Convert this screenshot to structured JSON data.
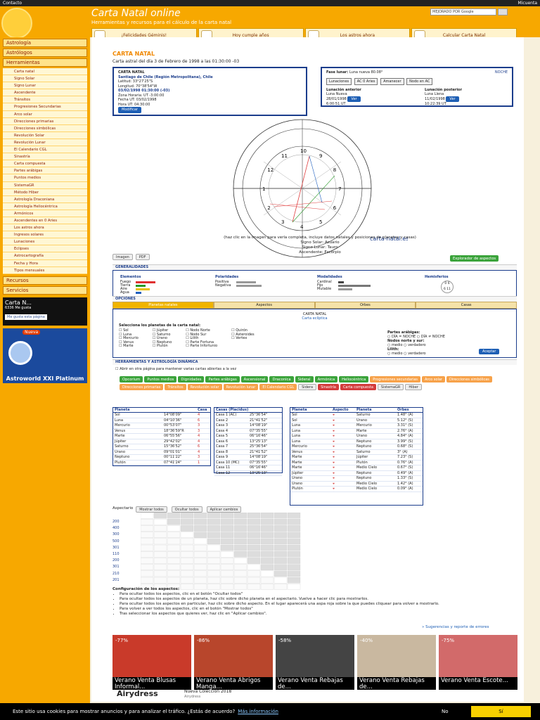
{
  "topbar": {
    "contact": "Contacto",
    "account": "Micuenta"
  },
  "header": {
    "brand": "Carta Natal online",
    "subtitle": "Herramientas y recursos para el cálculo de la carta natal",
    "search_placeholder": "MEJORADO POR Google",
    "nav": [
      "¡Felicidades Géminis!",
      "Hoy cumple años",
      "Los astros ahora",
      "Calcular Carta Natal"
    ]
  },
  "sidebar": {
    "sections": [
      {
        "label": "Astrología"
      },
      {
        "label": "Astrólogos"
      },
      {
        "label": "Herramientas"
      }
    ],
    "tools": [
      "Carta natal",
      "Signo Solar",
      "Signo Lunar",
      "Ascendente",
      "Tránsitos",
      "Progresiones Secundarias",
      "Arco solar",
      "Direcciones primarias",
      "Direcciones simbólicas",
      "Revolución Solar",
      "Revolución Lunar",
      "El Calendario CGL",
      "Sinastría",
      "Carta compuesta",
      "Partes arábigas",
      "Puntos medios",
      "SistemaGR",
      "Método Hiber",
      "Astrología Draconiana",
      "Astrología Heliocéntrica",
      "Armónicos",
      "Ascendentes en 0 Aries",
      "Los astros ahora",
      "Ingresos solares",
      "Lunaciones",
      "Eclipses",
      "Astrocartografía",
      "Fecha y Hora",
      "Tipos mensuales"
    ],
    "bottom": [
      "Recursos",
      "Servicios"
    ],
    "fb_card": {
      "title": "Carta N...",
      "likes": "6336 Me gusta",
      "like_btn": "Me gusta esta página"
    },
    "product": {
      "badge": "Nueva",
      "name": "Astroworld XXI Platinum"
    }
  },
  "main": {
    "title": "CARTA NATAL",
    "subtitle": "Carta astral del día 3 de Febrero de 1998 a las 01:30:00 -03",
    "box1": {
      "heading": "CARTA NATAL",
      "place": "Santiago de Chile (Región Metropolitana), Chile",
      "lat": "Latitud: 33°27'25\"S",
      "lon": "Longitud: 70°38'54\"W",
      "date": "03/02/1998 01:30:00 (-03)",
      "tz": "Zona Horaria: UT -3:00:00",
      "ut_date": "Fecha UT: 03/02/1998",
      "ut_time": "Hora UT: 04:30:00",
      "modify": "Modificar"
    },
    "box2": {
      "phase_label": "Fase lunar:",
      "phase": "Luna nueva 80.08°",
      "night": "NOCHE",
      "buttons": [
        "Lunaciones",
        "AC 0 Aries",
        "Amanecer",
        "Nodo en AC"
      ],
      "prev_label": "Lunación anterior",
      "prev_type": "Luna Nueva",
      "prev_date": "28/01/1998",
      "prev_time": "6:00:51 UT",
      "next_label": "Lunación posterior",
      "next_type": "Luna Llena",
      "next_date": "11/02/1998",
      "next_time": "10:22:39 UT",
      "ver": "Ver"
    },
    "chart_caption": "(haz clic en la imagen para verla completa, incluye datos natales y posiciones de planetas y casas)",
    "sign_solar": "Signo Solar: Acuario",
    "sign_lunar": "Signo Lunar: Tauro",
    "ascendente": "Ascendente: Escorpio",
    "chart_site": "carta-natal.es",
    "house_numbers": [
      "1",
      "2",
      "3",
      "4",
      "5",
      "6",
      "7",
      "8",
      "9",
      "10",
      "11",
      "12"
    ],
    "img_btn": "Imagen",
    "pdf_btn": "PDF",
    "aspects_explorer": "Explorador de aspectos",
    "general": {
      "title": "GENERALIDADES",
      "elements_title": "Elementos",
      "elements": [
        "Fuego",
        "Tierra",
        "Aire",
        "Agua"
      ],
      "polarity_title": "Polaridades",
      "polarity": [
        "Positiva",
        "Negativa"
      ],
      "modal_title": "Modalidades",
      "modal": [
        "Cardinal",
        "Fijo",
        "Mutable"
      ],
      "hemi_title": "Hemisferios",
      "hemi_values": [
        "0",
        "6",
        "6",
        "11"
      ]
    },
    "options": {
      "title": "OPCIONES",
      "tabs": [
        "Planetas natales",
        "Aspectos",
        "Orbes",
        "Casas"
      ],
      "chart_label": "CARTA NATAL",
      "chart_sub": "Carta eclíptica",
      "prompt": "Selecciona los planetas de la carta natal:",
      "col1": [
        "Sol",
        "Luna",
        "Mercurio",
        "Venus",
        "Marte"
      ],
      "col2": [
        "Júpiter",
        "Saturno",
        "Urano",
        "Neptuno",
        "Plutón"
      ],
      "col3": [
        "Nodo Norte",
        "Nodo Sur",
        "Lilith",
        "Parte Fortuna",
        "Parte Infortunio"
      ],
      "col4": [
        "Quirón",
        "Asteroides",
        "Vertex"
      ],
      "arabic_label": "Partes arábigas:",
      "arabic_opts": [
        "DÍA = NOCHE",
        "DÍA ≠ NOCHE"
      ],
      "nodes_label": "Nodos norte y sur:",
      "nodes_opts": [
        "medio",
        "verdadero"
      ],
      "lilith_label": "Lilith:",
      "lilith_opts": [
        "medio",
        "verdadero"
      ],
      "accept": "Aceptar"
    },
    "dyn_title": "HERRAMIENTAS Y ASTROLOGÍA DINÁMICA",
    "dyn_check": "Abrir en otra página para mantener varias cartas abiertas a la vez",
    "tools_green": [
      "Opcorium",
      "Puntos medios",
      "Dignidades",
      "Partes arábigas",
      "Ascensional",
      "Draconica",
      "Sideral",
      "Armónica",
      "Heliocéntrica"
    ],
    "tools_orange": [
      "Progresiones secundarias",
      "Arco solar",
      "Direcciones simbólicas",
      "Direcciones primarias",
      "Tránsitos",
      "Revolución solar",
      "Revolución lunar",
      "El Calendario CGL"
    ],
    "tools_red": [
      "Sinastría",
      "Carta compuesta"
    ],
    "tools_grey": [
      "Sidera",
      "SistemaGR",
      "Hiber"
    ],
    "planets_table": {
      "headers": [
        "Planeta",
        "",
        "Casa"
      ],
      "rows": [
        {
          "name": "Sol",
          "pos": "14°08'09\"",
          "casa": "4"
        },
        {
          "name": "Luna",
          "pos": "04°10'36\"",
          "casa": "6"
        },
        {
          "name": "Mercurio",
          "pos": "00°53'07\"",
          "casa": "3"
        },
        {
          "name": "Venus",
          "pos": "18°36'59\"R",
          "casa": "3"
        },
        {
          "name": "Marte",
          "pos": "06°55'56\"",
          "casa": "4"
        },
        {
          "name": "Júpiter",
          "pos": "29°42'02\"",
          "casa": "4"
        },
        {
          "name": "Saturno",
          "pos": "15°36'52\"",
          "casa": "6"
        },
        {
          "name": "Urano",
          "pos": "09°01'01\"",
          "casa": "4"
        },
        {
          "name": "Neptuno",
          "pos": "00°11'22\"",
          "casa": "3"
        },
        {
          "name": "Plutón",
          "pos": "07°41'24\"",
          "casa": "1"
        }
      ]
    },
    "houses_table": {
      "header": "Casas (Placidus)",
      "rows": [
        {
          "name": "Casa 1 (AC)",
          "pos": "25°36'54\""
        },
        {
          "name": "Casa 2",
          "pos": "21°41'52\""
        },
        {
          "name": "Casa 3",
          "pos": "14°08'19\""
        },
        {
          "name": "Casa 4",
          "pos": "07°35'55\""
        },
        {
          "name": "Casa 5",
          "pos": "06°16'46\""
        },
        {
          "name": "Casa 6",
          "pos": "13°25'13\""
        },
        {
          "name": "Casa 7",
          "pos": "25°36'54\""
        },
        {
          "name": "Casa 8",
          "pos": "21°41'52\""
        },
        {
          "name": "Casa 9",
          "pos": "14°08'19\""
        },
        {
          "name": "Casa 10 (MC)",
          "pos": "07°35'55\""
        },
        {
          "name": "Casa 11",
          "pos": "06°16'46\""
        },
        {
          "name": "Casa 12",
          "pos": "13°25'13\""
        }
      ]
    },
    "aspects_table": {
      "headers": [
        "Planeta",
        "Aspecto",
        "Planeta",
        "Orbes"
      ],
      "rows": [
        {
          "p1": "Sol",
          "p2": "Saturno",
          "orb": "1.48° (A)"
        },
        {
          "p1": "Sol",
          "p2": "Urano",
          "orb": "5.12° (S)"
        },
        {
          "p1": "Luna",
          "p2": "Mercurio",
          "orb": "3.31° (S)"
        },
        {
          "p1": "Luna",
          "p2": "Marte",
          "orb": "2.76° (A)"
        },
        {
          "p1": "Luna",
          "p2": "Urano",
          "orb": "4.84° (A)"
        },
        {
          "p1": "Luna",
          "p2": "Neptuno",
          "orb": "3.99° (S)"
        },
        {
          "p1": "Mercurio",
          "p2": "Neptuno",
          "orb": "0.68° (S)"
        },
        {
          "p1": "Venus",
          "p2": "Saturno",
          "orb": "3° (A)"
        },
        {
          "p1": "Marte",
          "p2": "Júpiter",
          "orb": "7.23° (S)"
        },
        {
          "p1": "Marte",
          "p2": "Plutón",
          "orb": "0.76° (A)"
        },
        {
          "p1": "Marte",
          "p2": "Medio Cielo",
          "orb": "0.67° (S)"
        },
        {
          "p1": "Júpiter",
          "p2": "Neptuno",
          "orb": "0.49° (A)"
        },
        {
          "p1": "Urano",
          "p2": "Neptuno",
          "orb": "1.33° (S)"
        },
        {
          "p1": "Urano",
          "p2": "Medio Cielo",
          "orb": "1.42° (A)"
        },
        {
          "p1": "Plutón",
          "p2": "Medio Cielo",
          "orb": "0.09° (A)"
        }
      ]
    },
    "aspectario": {
      "label": "Aspectario",
      "show_all": "Mostrar todos",
      "hide_all": "Ocultar todos",
      "apply": "Aplicar cambios",
      "row_nums": [
        "200",
        "400",
        "300",
        "500",
        "301",
        "110",
        "200",
        "301",
        "210",
        "201"
      ]
    },
    "config_title": "Configuración de los aspectos:",
    "config_notes": [
      "Para ocultar todos los aspectos, clic en el botón \"Ocultar todos\"",
      "Para ocultar todos los aspectos de un planeta, haz clic sobre dicho planeta en el aspectario. Vuelve a hacer clic para mostrarlos.",
      "Para ocultar todos los aspectos en particular, haz clic sobre dicho aspecto. En el lugar aparecerá una aspa roja sobre la que puedes cliquear para volver a mostrarlo.",
      "Para volver a ver todos los aspectos, clic en el botón \"Mostrar todos\"",
      "Tras seleccionar los aspectos que quieres ver, haz clic en \"Aplicar cambios\"."
    ],
    "suggestions": "» Sugerencias y reporte de errores",
    "ads": [
      {
        "pct": "-77%",
        "label": "Verano Venta Blusas Informal..."
      },
      {
        "pct": "-86%",
        "label": "Verano Venta Abrigos Manga..."
      },
      {
        "pct": "-58%",
        "label": "Verano Venta Rebajas de..."
      },
      {
        "pct": "-40%",
        "label": "Verano Venta Rebajas de..."
      },
      {
        "pct": "-75%",
        "label": "Verano Venta Escote..."
      }
    ],
    "ad_brand": "Airydress",
    "ad_tagline": "Nueva Colección 2018",
    "ad_sub": "Airydress"
  },
  "footer": {
    "text": "Este sitio usa cookies para mostrar anuncios y para analizar el tráfico. ¿Estás de acuerdo?",
    "more": "Más información",
    "no": "No",
    "si": "Sí"
  }
}
